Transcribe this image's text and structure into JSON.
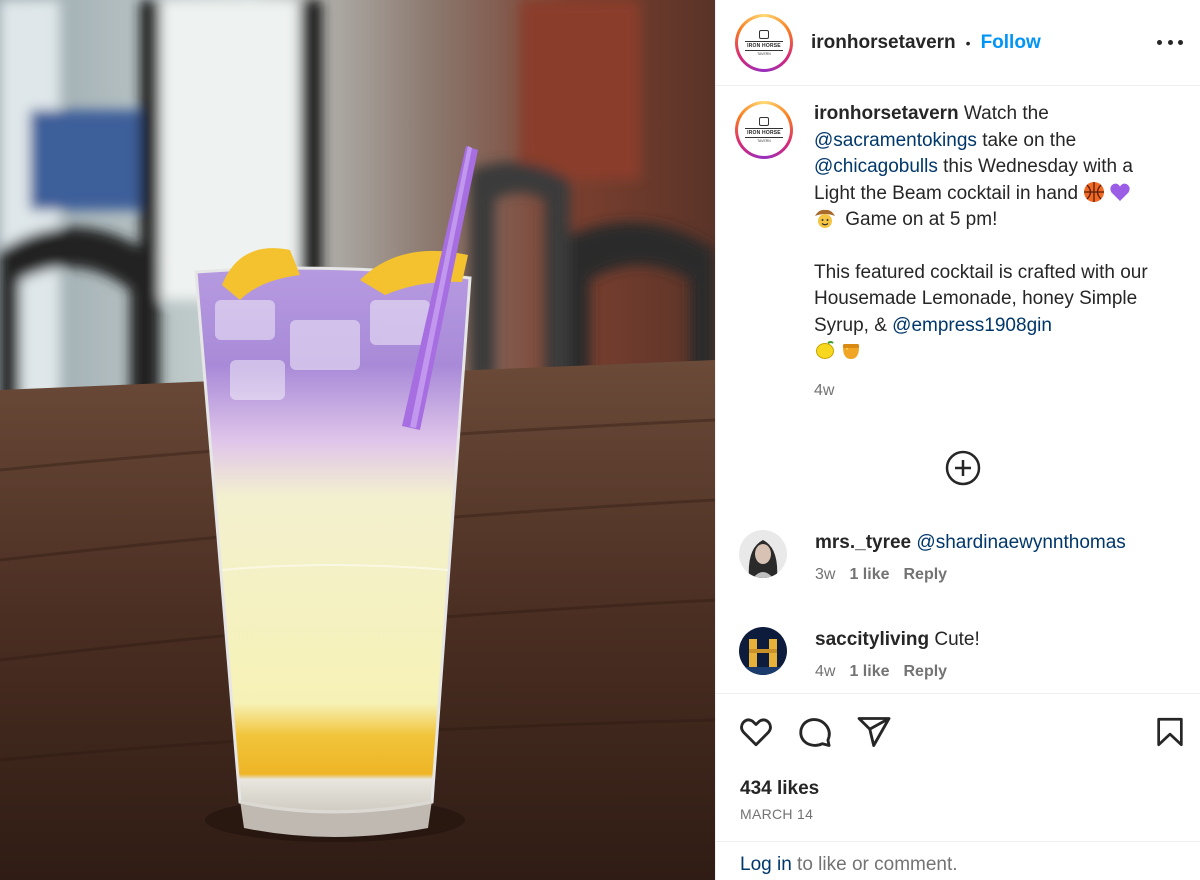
{
  "post": {
    "username": "ironhorsetavern",
    "separator": "•",
    "follow_label": "Follow",
    "logo_text": "IRON HORSE",
    "logo_sub": "TAVERN"
  },
  "caption": {
    "username": "ironhorsetavern",
    "t1": " Watch the ",
    "m1": "@sacramentokings",
    "t2": " take on the ",
    "m2": "@chicagobulls",
    "t3": " this Wednesday with a Light the Beam cocktail in hand ",
    "t4": " Game on at 5 pm!",
    "t5": "This featured cocktail is crafted with our Housemade Lemonade, honey Simple Syrup, & ",
    "m3": "@empress1908gin",
    "time": "4w",
    "emojis": [
      "basketball-emoji",
      "purple-heart-emoji",
      "cowboy-emoji",
      "lemon-emoji",
      "honey-pot-emoji"
    ]
  },
  "comments": [
    {
      "username": "mrs._tyree",
      "text": "",
      "mention": "@shardinaewynnthomas",
      "time": "3w",
      "likes": "1 like",
      "reply": "Reply"
    },
    {
      "username": "saccityliving",
      "text": " Cute!",
      "mention": "",
      "time": "4w",
      "likes": "1 like",
      "reply": "Reply"
    }
  ],
  "actions": {
    "likes": "434 likes",
    "date": "MARCH 14",
    "login_link": "Log in",
    "login_rest": " to like or comment."
  },
  "icons": [
    "heart-icon",
    "comment-icon",
    "share-icon",
    "bookmark-icon",
    "load-more-plus-icon",
    "more-options-icon"
  ],
  "colors": {
    "follow": "#0095f6",
    "mention": "#00376b",
    "muted": "#737373",
    "straw": "#a66ee0"
  }
}
